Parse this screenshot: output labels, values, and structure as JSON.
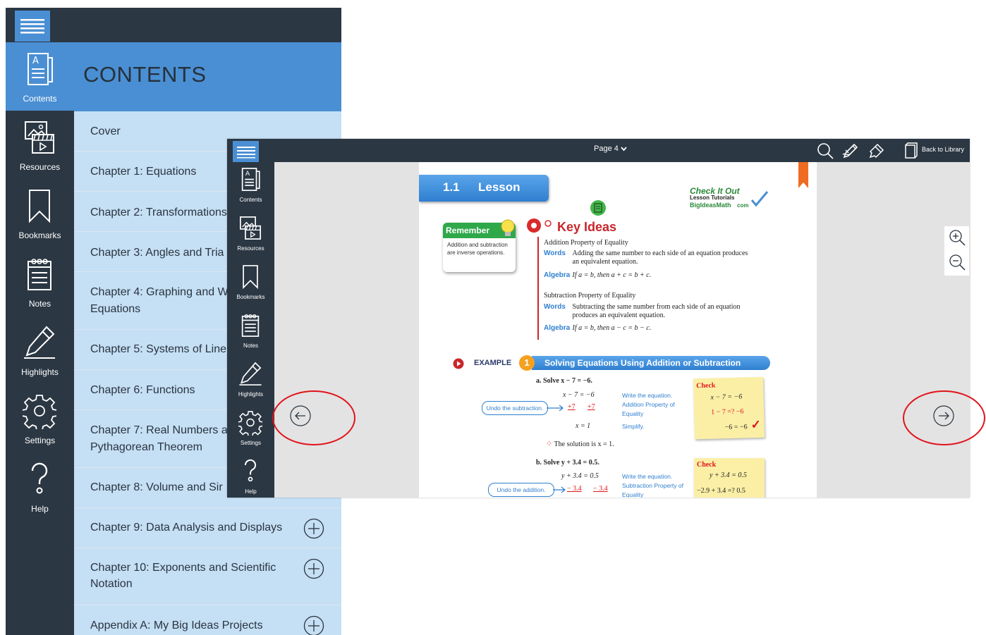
{
  "back_window": {
    "header_title": "CONTENTS",
    "rail": [
      {
        "label": "Contents",
        "icon": "contents-icon",
        "active": true
      },
      {
        "label": "Resources",
        "icon": "resources-icon"
      },
      {
        "label": "Bookmarks",
        "icon": "bookmark-icon"
      },
      {
        "label": "Notes",
        "icon": "notes-icon"
      },
      {
        "label": "Highlights",
        "icon": "highlighter-icon"
      },
      {
        "label": "Settings",
        "icon": "gear-icon"
      },
      {
        "label": "Help",
        "icon": "help-icon"
      }
    ],
    "contents_items": [
      {
        "label": "Cover",
        "expandable": false
      },
      {
        "label": "Chapter 1: Equations",
        "expandable": false
      },
      {
        "label": "Chapter 2: Transformations",
        "expandable": false
      },
      {
        "label": "Chapter 3: Angles and Tria",
        "expandable": false
      },
      {
        "label": "Chapter 4: Graphing and W",
        "label2": "Equations",
        "expandable": false
      },
      {
        "label": "Chapter 5: Systems of Line",
        "expandable": false
      },
      {
        "label": "Chapter 6: Functions",
        "expandable": false
      },
      {
        "label": "Chapter 7: Real Numbers a",
        "label2": "Pythagorean Theorem",
        "expandable": false
      },
      {
        "label": "Chapter 8: Volume and Sir",
        "expandable": false
      },
      {
        "label": "Chapter 9: Data Analysis and Displays",
        "expandable": true
      },
      {
        "label": "Chapter 10: Exponents and Scientific",
        "label2": "Notation",
        "expandable": true
      },
      {
        "label": "Appendix A: My Big Ideas Projects",
        "expandable": true
      }
    ]
  },
  "front_window": {
    "page_selector": "Page 4",
    "back_to_library": "Back to Library",
    "rail": [
      {
        "label": "Contents"
      },
      {
        "label": "Resources"
      },
      {
        "label": "Bookmarks"
      },
      {
        "label": "Notes"
      },
      {
        "label": "Highlights"
      },
      {
        "label": "Settings"
      },
      {
        "label": "Help"
      }
    ]
  },
  "book_page": {
    "lesson_number": "1.1",
    "lesson_label": "Lesson",
    "check_it_out": "Check It Out",
    "lesson_tutorials": "Lesson Tutorials",
    "site": "BigIdeasMath",
    "site_suffix": "com",
    "remember_title": "Remember",
    "remember_text": "Addition and subtraction are inverse operations.",
    "key_ideas": "Key Ideas",
    "addition_property_title": "Addition Property of Equality",
    "words_label": "Words",
    "algebra_label": "Algebra",
    "addition_words": "Adding the same number to each side of an equation produces an equivalent equation.",
    "addition_algebra": "If a = b, then a + c = b + c.",
    "subtraction_property_title": "Subtraction Property of Equality",
    "subtraction_words": "Subtracting the same number from each side of an equation produces an equivalent equation.",
    "subtraction_algebra": "If a = b, then a − c = b − c.",
    "example_label": "EXAMPLE",
    "example_number": "1",
    "example_title": "Solving Equations Using Addition or Subtraction",
    "part_a": "a. Solve  x − 7 = −6.",
    "a_line1": "x − 7 = −6",
    "a_line2_left": "+7",
    "a_line2_right": "+7",
    "a_line3": "x =    1",
    "a_note1": "Write the equation.",
    "a_note2": "Addition Property of Equality",
    "a_note3": "Simplify.",
    "a_undo": "Undo the subtraction.",
    "a_solution": "The solution is  x = 1.",
    "check_title": "Check",
    "a_check1": "x − 7 = −6",
    "a_check2": "1 − 7 =? −6",
    "a_check3": "−6 = −6",
    "check_mark": "✓",
    "part_b": "b. Solve  y + 3.4 = 0.5.",
    "b_line1": "y + 3.4 =     0.5",
    "b_line2_left": "− 3.4",
    "b_line2_right": "− 3.4",
    "b_note1": "Write the equation.",
    "b_note2": "Subtraction Property of Equality",
    "b_undo": "Undo the addition.",
    "b_check1": "y + 3.4 = 0.5",
    "b_check2": "−2.9 + 3.4 =? 0.5"
  }
}
